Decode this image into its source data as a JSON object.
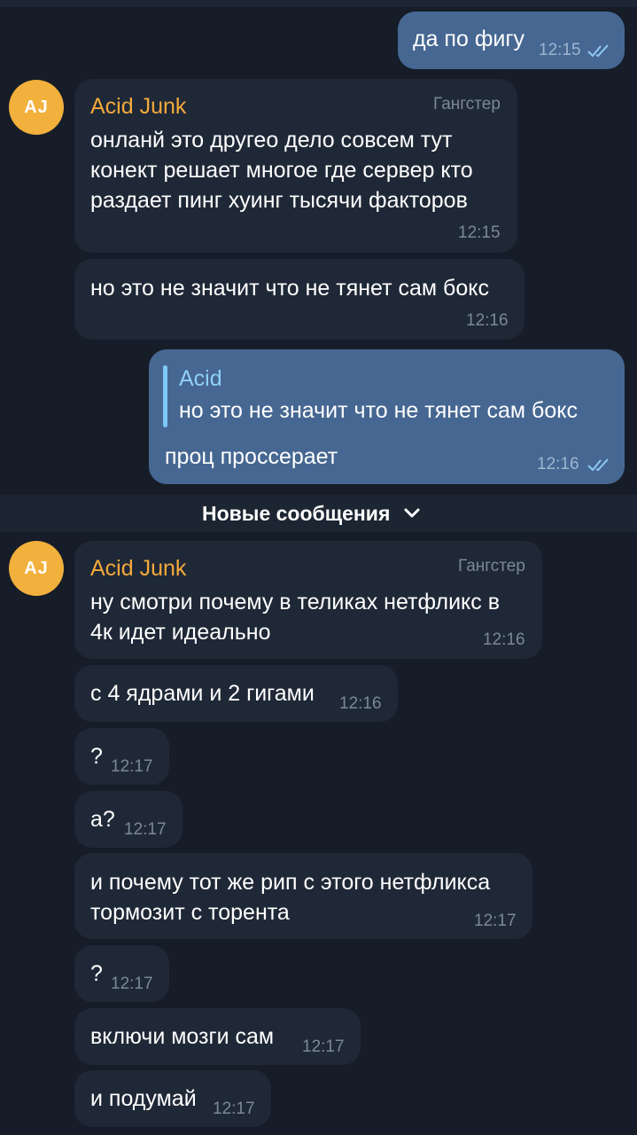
{
  "messages": {
    "m1": {
      "text": "да по фигу",
      "time": "12:15"
    },
    "m2": {
      "avatar": "AJ",
      "sender": "Acid Junk",
      "role": "Гангстер",
      "text": "онланй это другео дело совсем тут\nконект решает многое где сервер кто\nраздает пинг хуинг тысячи факторов",
      "time": "12:15"
    },
    "m3": {
      "text": "но это не значит что не тянет сам бокс",
      "time": "12:16"
    },
    "m4": {
      "reply_name": "Acid",
      "reply_text": "но это не значит что не тянет сам бокс",
      "text": "проц проссерает",
      "time": "12:16"
    },
    "m5": {
      "avatar": "AJ",
      "sender": "Acid Junk",
      "role": "Гангстер",
      "text": "ну смотри почему в теликах нетфликс в\n4к идет идеально",
      "time": "12:16"
    },
    "m6": {
      "text": "с 4 ядрами и 2 гигами",
      "time": "12:16"
    },
    "m7": {
      "text": "?",
      "time": "12:17"
    },
    "m8": {
      "text": "а?",
      "time": "12:17"
    },
    "m9": {
      "text": "и почему тот же рип с этого нетфликса\nтормозит с торента",
      "time": "12:17"
    },
    "m10": {
      "text": "?",
      "time": "12:17"
    },
    "m11": {
      "text": "включи мозги сам",
      "time": "12:17"
    },
    "m12": {
      "text": "и подумай",
      "time": "12:17"
    }
  },
  "divider": {
    "label": "Новые сообщения",
    "icon": "chevron-down-icon"
  },
  "icons": {
    "read_receipt": "double-check-icon"
  },
  "colors": {
    "background": "#161d28",
    "incoming_bubble": "#1f2836",
    "outgoing_bubble": "#466792",
    "avatar": "#f2b03c",
    "sender_name": "#f4a93c",
    "reply_accent": "#7ec8f8",
    "read_check": "#8fc9f5"
  }
}
